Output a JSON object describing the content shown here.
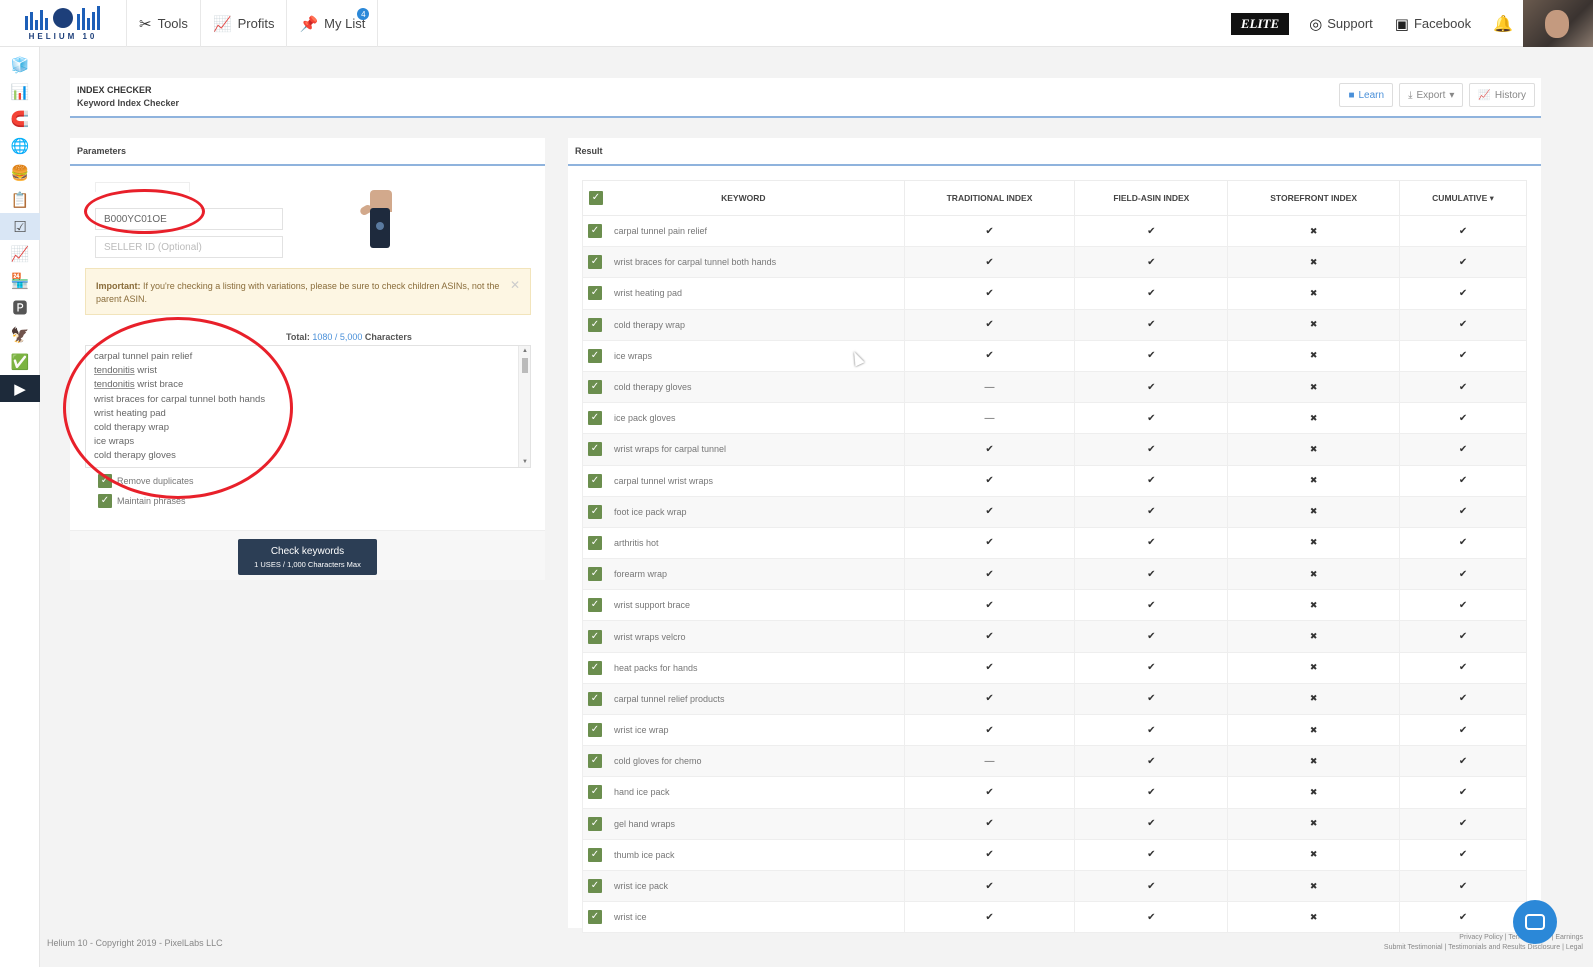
{
  "app": {
    "logo_text": "HELIUM 10"
  },
  "nav": {
    "tabs": [
      {
        "label": "Tools",
        "icon": "tools-icon"
      },
      {
        "label": "Profits",
        "icon": "chart-line-icon"
      },
      {
        "label": "My List",
        "icon": "pin-icon",
        "badge": "4"
      }
    ]
  },
  "top_right": {
    "elite": "ELITE",
    "support": "Support",
    "facebook": "Facebook"
  },
  "header": {
    "title": "INDEX CHECKER",
    "subtitle": "Keyword Index Checker",
    "learn": "Learn",
    "export": "Export",
    "history": "History"
  },
  "params": {
    "title": "Parameters",
    "asin_value": "B000YC01OE",
    "seller_placeholder": "SELLER ID (Optional)",
    "alert_bold": "Important:",
    "alert_text": "If you're checking a listing with variations, please be sure to check children ASINs, not the parent ASIN.",
    "total_label": "Total:",
    "total_value": "1080 / 5,000",
    "total_unit": "Characters",
    "remove_duplicates": "Remove duplicates",
    "maintain_phrases": "Maintain phrases",
    "check_button": "Check keywords",
    "check_sub": "1 USES / 1,000 Characters Max"
  },
  "keyword_lines": [
    {
      "pre": "",
      "u": "",
      "post": "carpal tunnel pain relief"
    },
    {
      "pre": "",
      "u": "tendonitis",
      "post": " wrist"
    },
    {
      "pre": "",
      "u": "tendonitis",
      "post": " wrist brace"
    },
    {
      "pre": "",
      "u": "",
      "post": "wrist braces for carpal tunnel both hands"
    },
    {
      "pre": "",
      "u": "",
      "post": "wrist heating pad"
    },
    {
      "pre": "",
      "u": "",
      "post": "cold therapy wrap"
    },
    {
      "pre": "",
      "u": "",
      "post": "ice wraps"
    },
    {
      "pre": "",
      "u": "",
      "post": "cold therapy gloves"
    }
  ],
  "result": {
    "title": "Result",
    "columns": [
      "KEYWORD",
      "TRADITIONAL INDEX",
      "FIELD-ASIN INDEX",
      "STOREFRONT INDEX",
      "CUMULATIVE ▾"
    ],
    "rows": [
      {
        "keyword": "carpal tunnel pain relief",
        "trad": "yes",
        "field": "yes",
        "store": "no",
        "cum": "yes"
      },
      {
        "keyword": "wrist braces for carpal tunnel both hands",
        "trad": "yes",
        "field": "yes",
        "store": "no",
        "cum": "yes"
      },
      {
        "keyword": "wrist heating pad",
        "trad": "yes",
        "field": "yes",
        "store": "no",
        "cum": "yes"
      },
      {
        "keyword": "cold therapy wrap",
        "trad": "yes",
        "field": "yes",
        "store": "no",
        "cum": "yes"
      },
      {
        "keyword": "ice wraps",
        "trad": "yes",
        "field": "yes",
        "store": "no",
        "cum": "yes"
      },
      {
        "keyword": "cold therapy gloves",
        "trad": "dash",
        "field": "yes",
        "store": "no",
        "cum": "yes"
      },
      {
        "keyword": "ice pack gloves",
        "trad": "dash",
        "field": "yes",
        "store": "no",
        "cum": "yes"
      },
      {
        "keyword": "wrist wraps for carpal tunnel",
        "trad": "yes",
        "field": "yes",
        "store": "no",
        "cum": "yes"
      },
      {
        "keyword": "carpal tunnel wrist wraps",
        "trad": "yes",
        "field": "yes",
        "store": "no",
        "cum": "yes"
      },
      {
        "keyword": "foot ice pack wrap",
        "trad": "yes",
        "field": "yes",
        "store": "no",
        "cum": "yes"
      },
      {
        "keyword": "arthritis hot",
        "trad": "yes",
        "field": "yes",
        "store": "no",
        "cum": "yes"
      },
      {
        "keyword": "forearm wrap",
        "trad": "yes",
        "field": "yes",
        "store": "no",
        "cum": "yes"
      },
      {
        "keyword": "wrist support brace",
        "trad": "yes",
        "field": "yes",
        "store": "no",
        "cum": "yes"
      },
      {
        "keyword": "wrist wraps velcro",
        "trad": "yes",
        "field": "yes",
        "store": "no",
        "cum": "yes"
      },
      {
        "keyword": "heat packs for hands",
        "trad": "yes",
        "field": "yes",
        "store": "no",
        "cum": "yes"
      },
      {
        "keyword": "carpal tunnel relief products",
        "trad": "yes",
        "field": "yes",
        "store": "no",
        "cum": "yes"
      },
      {
        "keyword": "wrist ice wrap",
        "trad": "yes",
        "field": "yes",
        "store": "no",
        "cum": "yes"
      },
      {
        "keyword": "cold gloves for chemo",
        "trad": "dash",
        "field": "yes",
        "store": "no",
        "cum": "yes"
      },
      {
        "keyword": "hand ice pack",
        "trad": "yes",
        "field": "yes",
        "store": "no",
        "cum": "yes"
      },
      {
        "keyword": "gel hand wraps",
        "trad": "yes",
        "field": "yes",
        "store": "no",
        "cum": "yes"
      },
      {
        "keyword": "thumb ice pack",
        "trad": "yes",
        "field": "yes",
        "store": "no",
        "cum": "yes"
      },
      {
        "keyword": "wrist ice pack",
        "trad": "yes",
        "field": "yes",
        "store": "no",
        "cum": "yes"
      },
      {
        "keyword": "wrist ice",
        "trad": "yes",
        "field": "yes",
        "store": "no",
        "cum": "yes"
      }
    ]
  },
  "footer": {
    "copyright": "Helium 10 - Copyright 2019 - PixelLabs LLC",
    "links1": "Privacy Policy | Terms of Use | Earnings",
    "links2": "Submit Testimonial | Testimonials and Results Disclosure | Legal"
  },
  "colors": {
    "accent": "#2b88d8",
    "check_green": "#6b8e4e",
    "button_dark": "#2c3e55",
    "annotation_red": "#e8202a"
  }
}
